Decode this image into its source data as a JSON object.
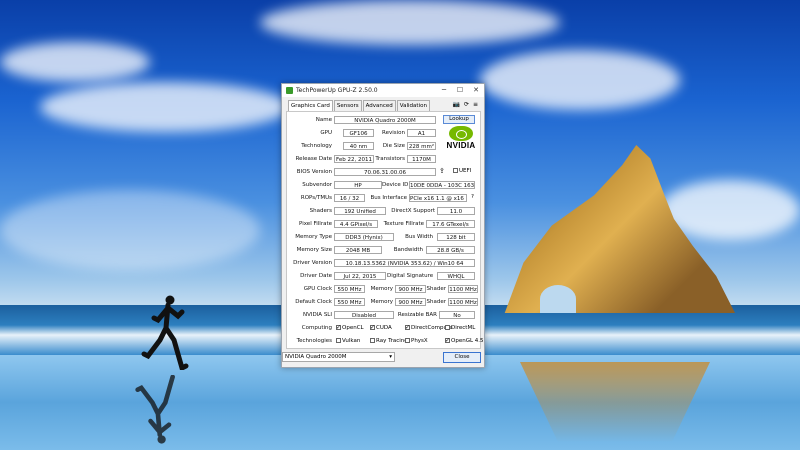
{
  "window": {
    "title": "TechPowerUp GPU-Z 2.50.0",
    "controls": {
      "minimize": "─",
      "maximize": "☐",
      "close": "✕"
    }
  },
  "tabs": [
    "Graphics Card",
    "Sensors",
    "Advanced",
    "Validation"
  ],
  "tab_icons": [
    "camera-icon",
    "refresh-icon",
    "menu-icon"
  ],
  "fields": {
    "name_label": "Name",
    "name": "NVIDIA Quadro 2000M",
    "lookup": "Lookup",
    "gpu_label": "GPU",
    "gpu": "GF106",
    "revision_label": "Revision",
    "revision": "A1",
    "technology_label": "Technology",
    "technology": "40 nm",
    "die_size_label": "Die Size",
    "die_size": "228 mm²",
    "release_date_label": "Release Date",
    "release_date": "Feb 22, 2011",
    "transistors_label": "Transistors",
    "transistors": "1170M",
    "bios_label": "BIOS Version",
    "bios": "70.06.31.00.06",
    "uefi": "UEFI",
    "subvendor_label": "Subvendor",
    "subvendor": "HP",
    "device_id_label": "Device ID",
    "device_id": "10DE 0DDA - 103C 1631",
    "rops_label": "ROPs/TMUs",
    "rops": "16 / 32",
    "bus_interface_label": "Bus Interface",
    "bus_interface": "PCIe x16 1.1 @ x16 1.1",
    "bus_help": "?",
    "shaders_label": "Shaders",
    "shaders": "192 Unified",
    "directx_label": "DirectX Support",
    "directx": "11.0",
    "pixel_fillrate_label": "Pixel Fillrate",
    "pixel_fillrate": "4.4 GPixel/s",
    "texture_fillrate_label": "Texture Fillrate",
    "texture_fillrate": "17.6 GTexel/s",
    "memory_type_label": "Memory Type",
    "memory_type": "DDR3 (Hynix)",
    "bus_width_label": "Bus Width",
    "bus_width": "128 bit",
    "memory_size_label": "Memory Size",
    "memory_size": "2048 MB",
    "bandwidth_label": "Bandwidth",
    "bandwidth": "28.8 GB/s",
    "driver_version_label": "Driver Version",
    "driver_version": "10.18.13.5362 (NVIDIA 353.62) / Win10 64",
    "driver_date_label": "Driver Date",
    "driver_date": "Jul 22, 2015",
    "digital_signature_label": "Digital Signature",
    "digital_signature": "WHQL",
    "gpu_clock_label": "GPU Clock",
    "gpu_clock": "550 MHz",
    "memory_label": "Memory",
    "gpu_memory": "900 MHz",
    "shader_label": "Shader",
    "gpu_shader": "1100 MHz",
    "default_clock_label": "Default Clock",
    "default_clock": "550 MHz",
    "default_memory": "900 MHz",
    "default_shader": "1100 MHz",
    "sli_label": "NVIDIA SLI",
    "sli": "Disabled",
    "resizable_bar_label": "Resizable BAR",
    "resizable_bar": "No",
    "computing_label": "Computing",
    "technologies_label": "Technologies"
  },
  "computing": [
    {
      "label": "OpenCL",
      "checked": true
    },
    {
      "label": "CUDA",
      "checked": true
    },
    {
      "label": "DirectCompute",
      "checked": true
    },
    {
      "label": "DirectML",
      "checked": false
    }
  ],
  "technologies": [
    {
      "label": "Vulkan",
      "checked": false
    },
    {
      "label": "Ray Tracing",
      "checked": false
    },
    {
      "label": "PhysX",
      "checked": false
    },
    {
      "label": "OpenGL 4.5",
      "checked": true
    }
  ],
  "vendor_logo": "NVIDIA",
  "footer": {
    "selected_gpu": "NVIDIA Quadro 2000M",
    "close": "Close"
  }
}
